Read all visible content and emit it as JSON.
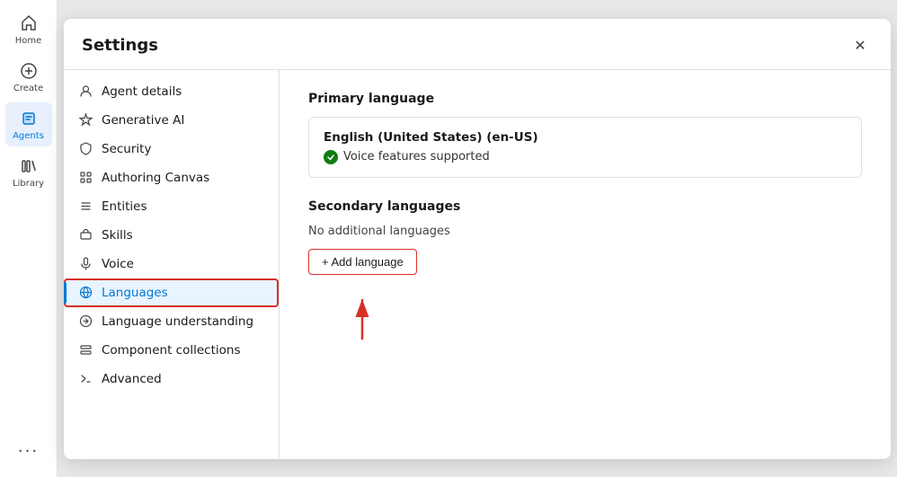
{
  "nav": {
    "items": [
      {
        "id": "home",
        "label": "Home",
        "active": false
      },
      {
        "id": "create",
        "label": "Create",
        "active": false
      },
      {
        "id": "agents",
        "label": "Agents",
        "active": true
      },
      {
        "id": "library",
        "label": "Library",
        "active": false
      }
    ],
    "more_label": "..."
  },
  "settings": {
    "title": "Settings",
    "close_label": "✕",
    "sidebar": {
      "items": [
        {
          "id": "agent-details",
          "label": "Agent details",
          "icon": "agent-icon"
        },
        {
          "id": "generative-ai",
          "label": "Generative AI",
          "icon": "sparkle-icon"
        },
        {
          "id": "security",
          "label": "Security",
          "icon": "security-icon"
        },
        {
          "id": "authoring-canvas",
          "label": "Authoring Canvas",
          "icon": "grid-icon"
        },
        {
          "id": "entities",
          "label": "Entities",
          "icon": "entities-icon"
        },
        {
          "id": "skills",
          "label": "Skills",
          "icon": "skills-icon"
        },
        {
          "id": "voice",
          "label": "Voice",
          "icon": "voice-icon"
        },
        {
          "id": "languages",
          "label": "Languages",
          "icon": "languages-icon",
          "active": true
        },
        {
          "id": "language-understanding",
          "label": "Language understanding",
          "icon": "understanding-icon"
        },
        {
          "id": "component-collections",
          "label": "Component collections",
          "icon": "collections-icon"
        },
        {
          "id": "advanced",
          "label": "Advanced",
          "icon": "advanced-icon"
        }
      ]
    },
    "content": {
      "primary_language_section": "Primary language",
      "primary_language_name": "English (United States) (en-US)",
      "primary_language_supported": "Voice features supported",
      "secondary_language_section": "Secondary languages",
      "no_languages_text": "No additional languages",
      "add_language_label": "+ Add language"
    }
  }
}
